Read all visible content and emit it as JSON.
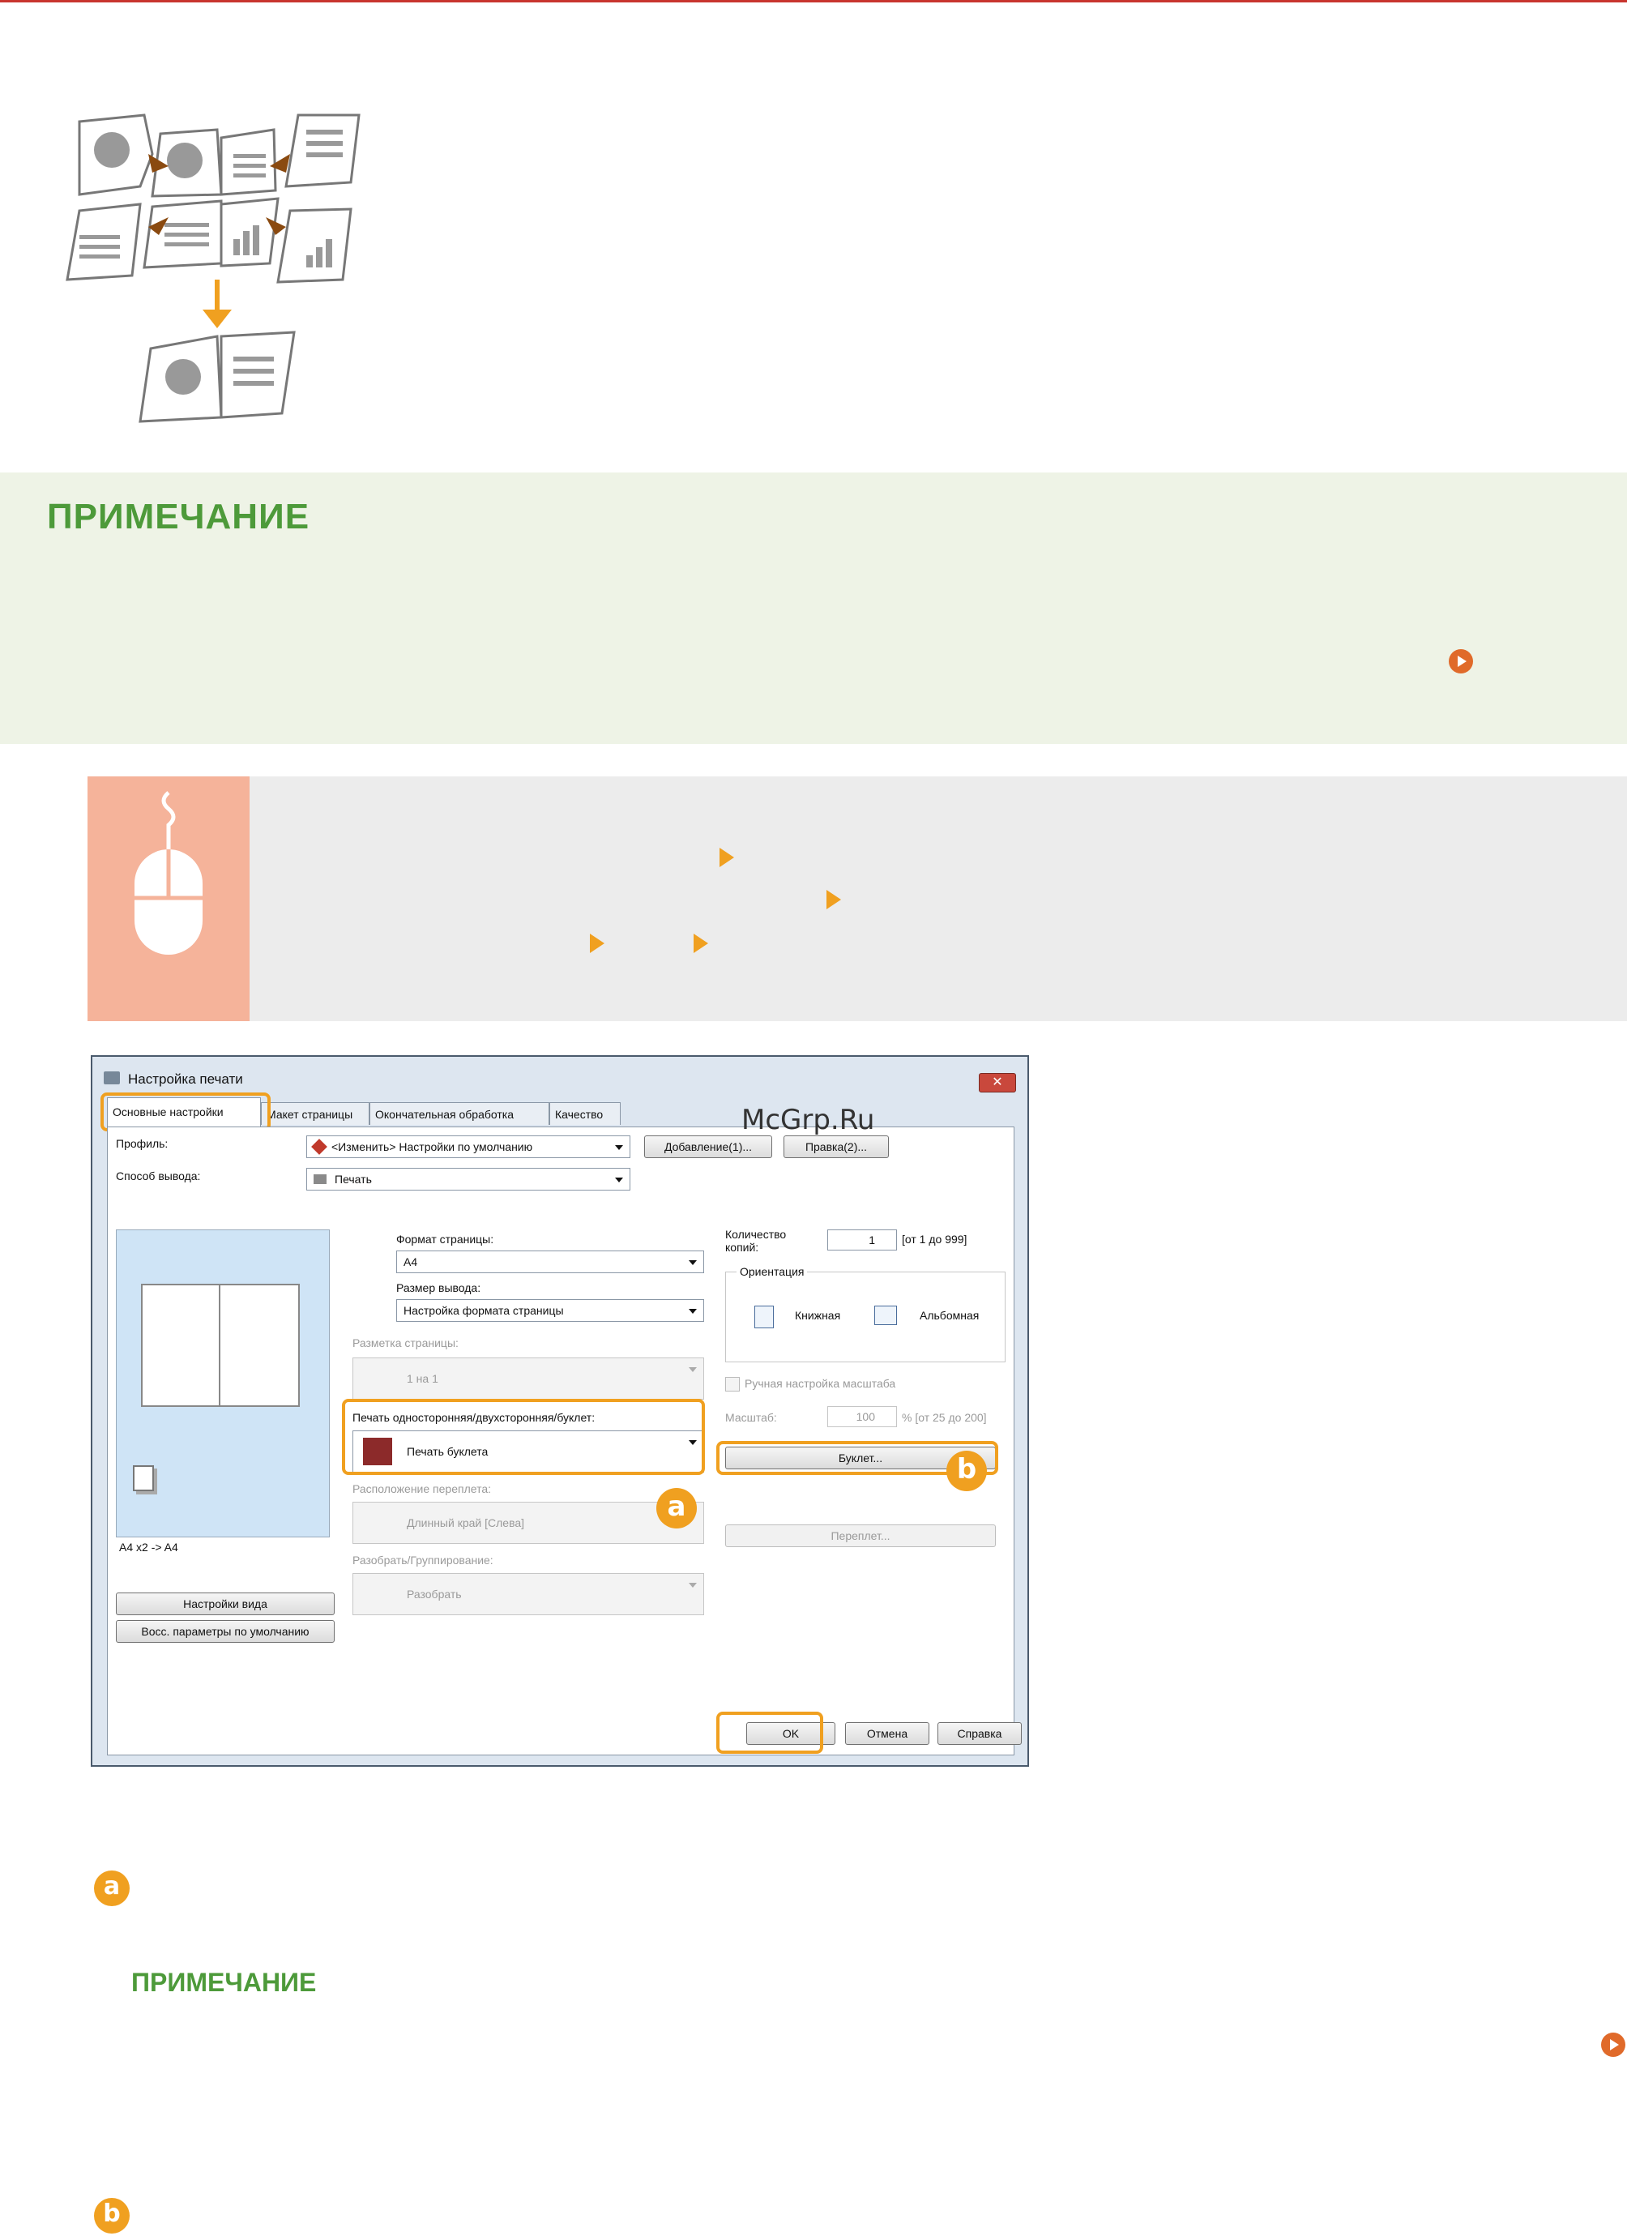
{
  "note": {
    "title": "ПРИМЕЧАНИЕ"
  },
  "dialog": {
    "title": "Настройка печати",
    "close_glyph": "✕",
    "tabs": [
      "Основные настройки",
      "Макет страницы",
      "Окончательная обработка",
      "Качество"
    ],
    "profile_label": "Профиль:",
    "profile_value": "<Изменить> Настройки по умолчанию",
    "add_button": "Добавление(1)...",
    "edit_button": "Правка(2)...",
    "output_label": "Способ вывода:",
    "output_value": "Печать",
    "page_size_label": "Формат страницы:",
    "page_size_value": "A4",
    "output_size_label": "Размер вывода:",
    "output_size_value": "Настройка формата страницы",
    "layout_label": "Разметка страницы:",
    "layout_value": "1 на 1",
    "duplex_label": "Печать односторонняя/двухсторонняя/буклет:",
    "duplex_value": "Печать буклета",
    "binding_label": "Расположение переплета:",
    "binding_value": "Длинный край [Слева]",
    "collate_label": "Разобрать/Группирование:",
    "collate_value": "Разобрать",
    "copies_label": "Количество копий:",
    "copies_value": "1",
    "copies_range": "[от 1 до 999]",
    "orientation_label": "Ориентация",
    "portrait": "Книжная",
    "landscape": "Альбомная",
    "manual_scale": "Ручная настройка масштаба",
    "scale_label": "Масштаб:",
    "scale_value": "100",
    "scale_range": "% [от 25 до 200]",
    "booklet_button": "Буклет...",
    "binding_button": "Переплет...",
    "preview_caption": "A4 x2 -> A4",
    "view_settings_button": "Настройки вида",
    "restore_button": "Восс. параметры по умолчанию",
    "ok_button": "OK",
    "cancel_button": "Отмена",
    "help_button": "Справка"
  },
  "callouts": {
    "a": "a",
    "b": "b"
  },
  "watermark": "McGrp.Ru",
  "sub_note": {
    "title": "ПРИМЕЧАНИЕ"
  },
  "colors": {
    "accent": "#f0a020",
    "note_green": "#4d9a3a",
    "mouse_panel": "#f5b39a"
  }
}
